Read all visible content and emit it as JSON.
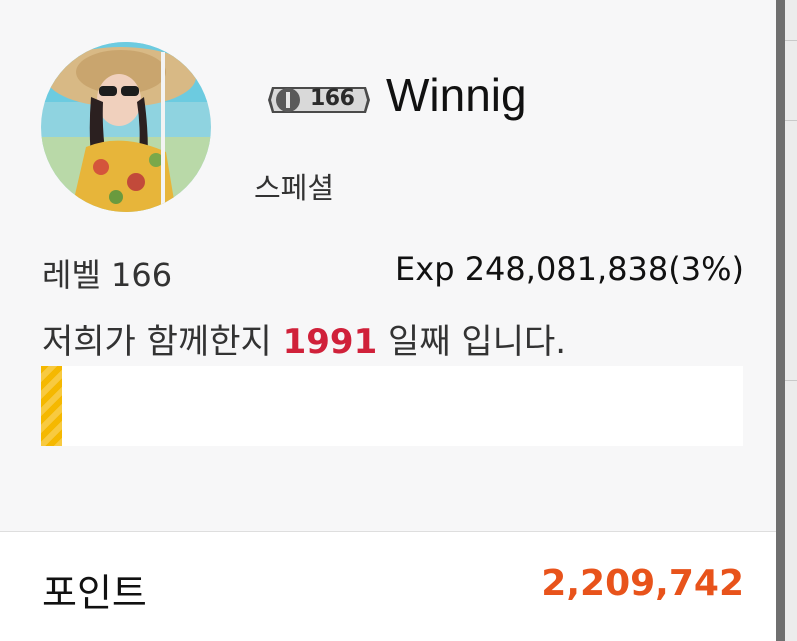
{
  "profile": {
    "level_badge": "166",
    "username": "Winnig",
    "user_type": "스페셜",
    "level_text": "레벨 166",
    "exp_text": "Exp 248,081,838(3%)",
    "days_prefix": "저희가 함께한지",
    "days_count": "1991",
    "days_suffix": "일째 입니다.",
    "exp_progress_percent": 3
  },
  "points": {
    "label": "포인트",
    "value": "2,209,742"
  },
  "colors": {
    "days_count": "#d0213a",
    "points_value": "#e8531b",
    "progress_fill": "#f5b800"
  }
}
